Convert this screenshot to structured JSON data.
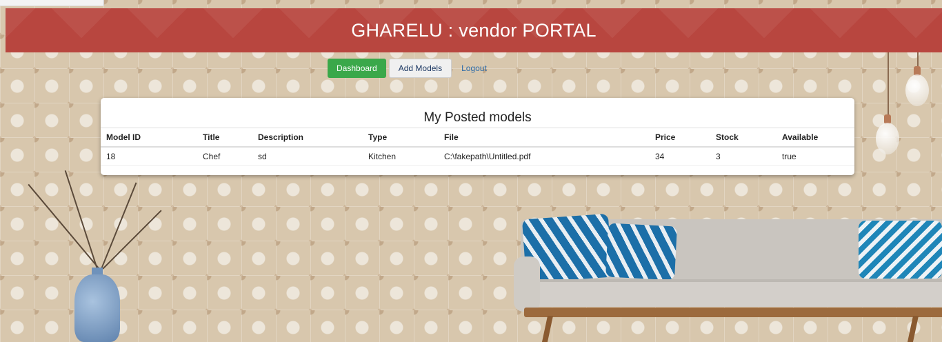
{
  "header": {
    "title": "GHARELU : vendor PORTAL"
  },
  "nav": {
    "dashboard_label": "Dashboard",
    "add_models_label": "Add Models",
    "logout_label": "Logout"
  },
  "panel": {
    "title": "My Posted models",
    "columns": [
      "Model ID",
      "Title",
      "Description",
      "Type",
      "File",
      "Price",
      "Stock",
      "Available"
    ],
    "rows": [
      [
        "18",
        "Chef",
        "sd",
        "Kitchen",
        "C:\\fakepath\\Untitled.pdf",
        "34",
        "3",
        "true"
      ]
    ]
  },
  "colors": {
    "header_bg": "#b8463f",
    "success": "#3aa84a",
    "link": "#2d6ba8"
  }
}
